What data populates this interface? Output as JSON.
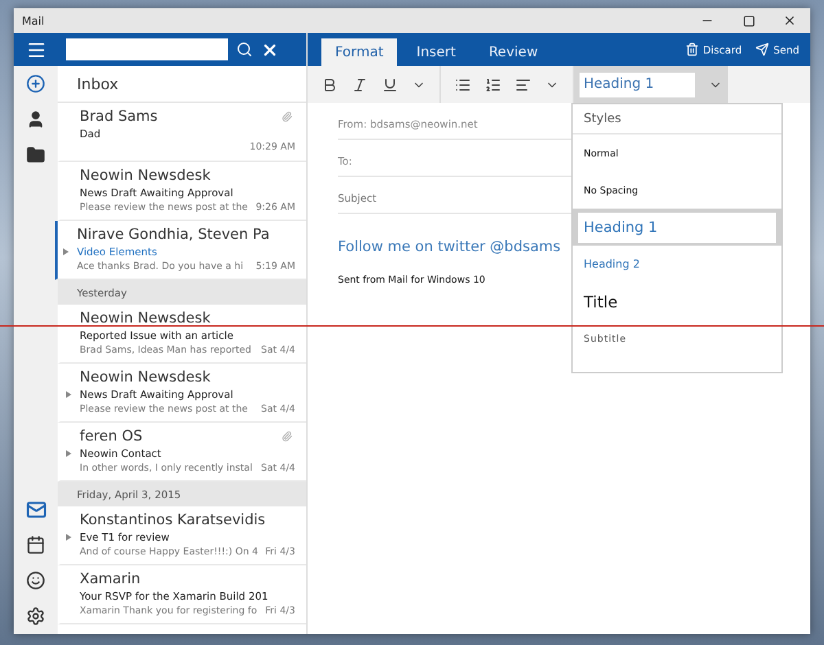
{
  "window": {
    "title": "Mail"
  },
  "folder": {
    "title": "Inbox"
  },
  "messages": [
    {
      "kind": "message",
      "sender": "Brad Sams",
      "subject": "Dad",
      "time": "10:29 AM",
      "attachment": true,
      "thread": false,
      "selected": false
    },
    {
      "kind": "message",
      "sender": "Neowin Newsdesk",
      "subject": "News Draft Awaiting Approval",
      "preview": "Please review the news post at the",
      "time": "9:26 AM",
      "attachment": false,
      "thread": false,
      "selected": false
    },
    {
      "kind": "message",
      "sender": "Nirave Gondhia, Steven Pa",
      "subject": "Video Elements",
      "preview": "Ace thanks Brad. Do you have a hi",
      "time": "5:19 AM",
      "attachment": false,
      "thread": true,
      "selected": true
    },
    {
      "kind": "header",
      "label": "Yesterday"
    },
    {
      "kind": "message",
      "sender": "Neowin Newsdesk",
      "subject": "Reported Issue with an article",
      "preview": "Brad Sams, Ideas Man has reported",
      "time": "Sat 4/4",
      "attachment": false,
      "thread": false,
      "selected": false
    },
    {
      "kind": "message",
      "sender": "Neowin Newsdesk",
      "subject": "News Draft Awaiting Approval",
      "preview": "Please review the news post at the",
      "time": "Sat 4/4",
      "attachment": false,
      "thread": true,
      "selected": false
    },
    {
      "kind": "message",
      "sender": "feren OS",
      "subject": "Neowin Contact",
      "preview": "In other words, I only recently instal",
      "time": "Sat 4/4",
      "attachment": true,
      "thread": true,
      "selected": false
    },
    {
      "kind": "header",
      "label": "Friday, April 3, 2015"
    },
    {
      "kind": "message",
      "sender": "Konstantinos Karatsevidis",
      "subject": "Eve T1 for review",
      "preview": "And of course Happy Easter!!!:) On 4",
      "time": "Fri 4/3",
      "attachment": false,
      "thread": true,
      "selected": false
    },
    {
      "kind": "message",
      "sender": "Xamarin",
      "subject": "Your RSVP for the Xamarin Build 201",
      "preview": "Xamarin Thank you for registering fo",
      "time": "Fri 4/3",
      "attachment": false,
      "thread": false,
      "selected": false
    }
  ],
  "tabs": [
    {
      "label": "Format",
      "selected": true
    },
    {
      "label": "Insert",
      "selected": false
    },
    {
      "label": "Review",
      "selected": false
    }
  ],
  "actions": [
    "Discard",
    "Send"
  ],
  "style_field": {
    "value": "Heading 1"
  },
  "compose": {
    "from": "From:  bdsams@neowin.net",
    "to": "To:",
    "subject_placeholder": "Subject",
    "body": "Follow me on twitter @bdsams",
    "signature": "Sent from Mail for Windows 10"
  },
  "styles": {
    "title": "Styles",
    "items": [
      {
        "label": "Normal",
        "kind": "normal",
        "selected": false
      },
      {
        "label": "No Spacing",
        "kind": "normal",
        "selected": false
      },
      {
        "label": "Heading 1",
        "kind": "heading1",
        "selected": true
      },
      {
        "label": "Heading 2",
        "kind": "heading2",
        "selected": false
      },
      {
        "label": "Title",
        "kind": "title",
        "selected": false
      },
      {
        "label": "Subtitle",
        "kind": "subtitle",
        "selected": false
      }
    ]
  }
}
